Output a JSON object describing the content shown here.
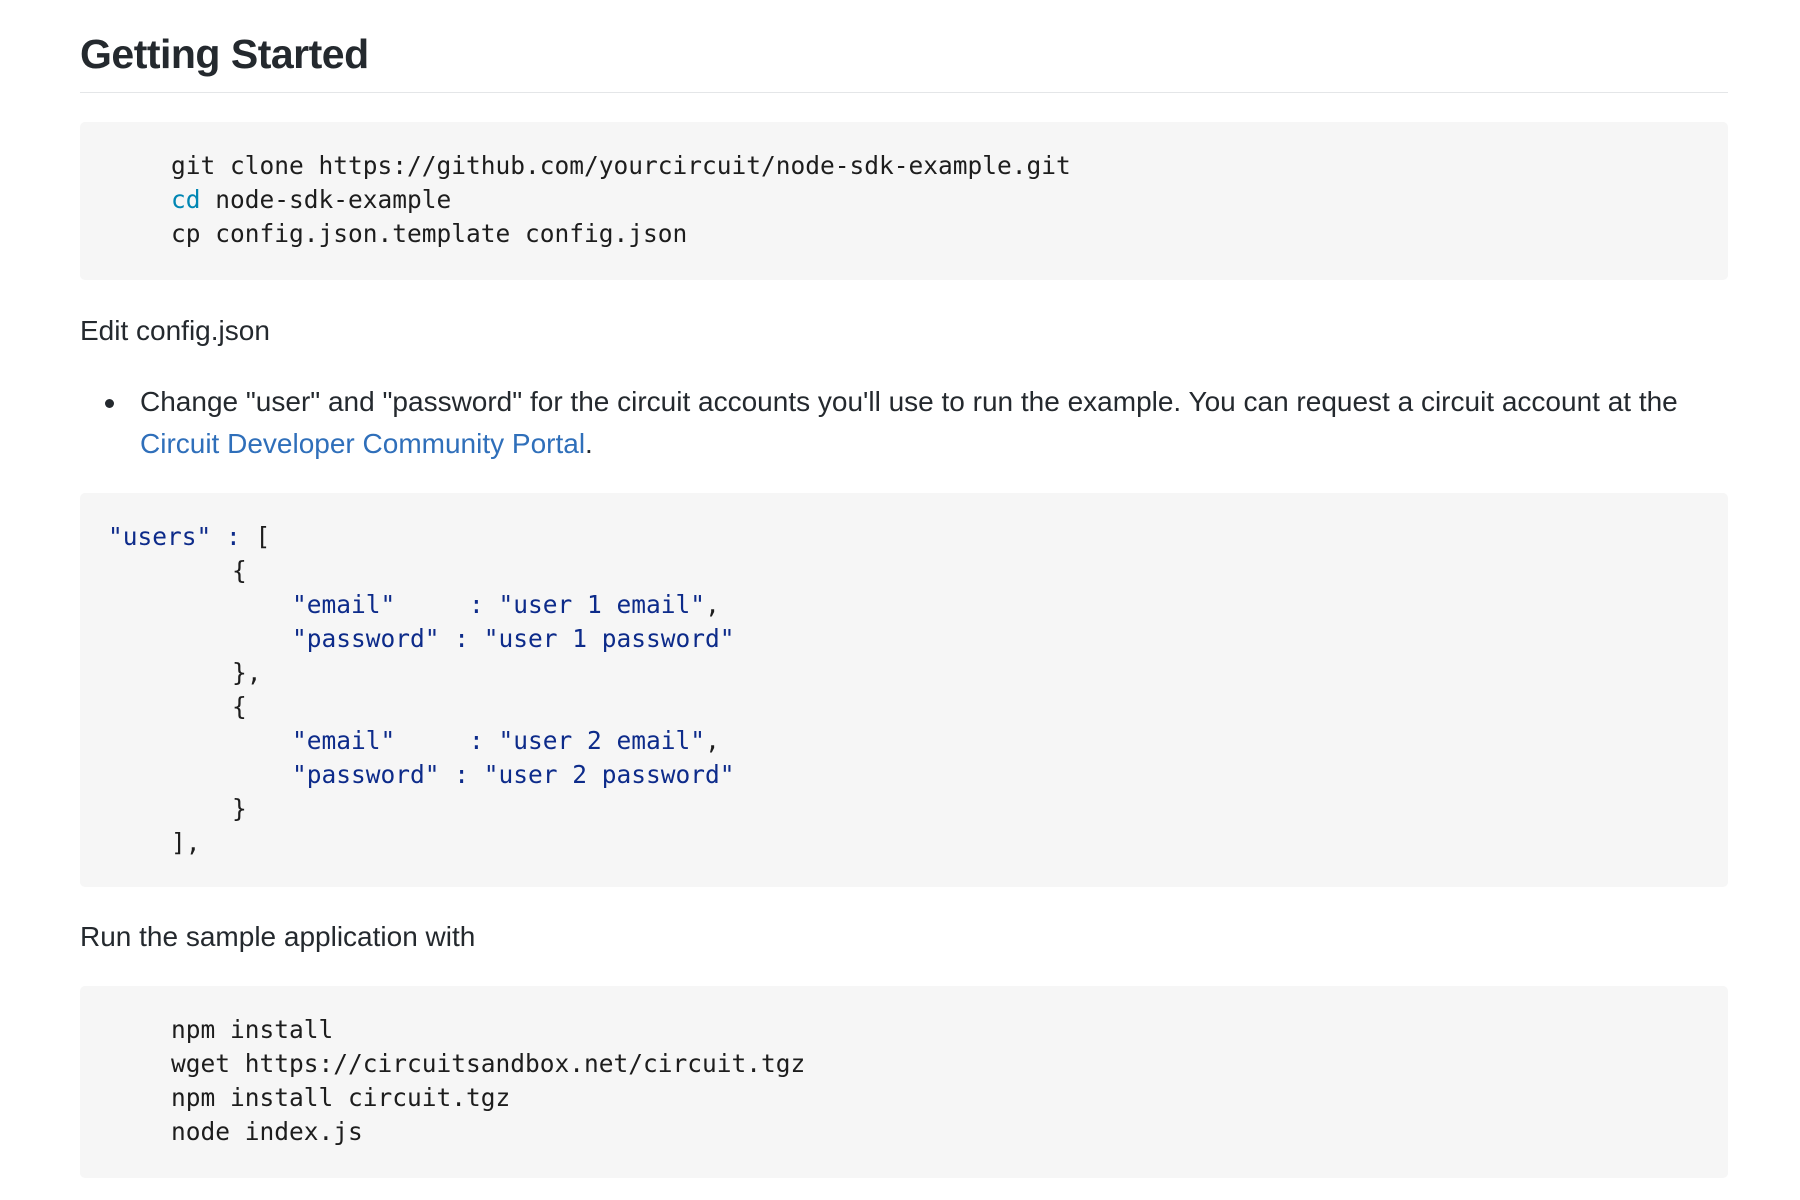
{
  "heading": "Getting Started",
  "code_clone": {
    "line1": "git clone https://github.com/yourcircuit/node-sdk-example.git",
    "line2_cmd": "cd",
    "line2_rest": " node-sdk-example",
    "line3": "cp config.json.template config.json"
  },
  "edit_text": "Edit config.json",
  "bullet": {
    "text_before": "Change \"user\" and \"password\" for the circuit accounts you'll use to run the example. You can request a circuit account at the ",
    "link_text": "Circuit Developer Community Portal",
    "text_after": "."
  },
  "code_config": {
    "users_key": "\"users\"",
    "colon": " : ",
    "open_bracket": "[",
    "open_brace": "{",
    "close_brace_comma": "},",
    "close_brace": "}",
    "close_bracket": "],",
    "email_key": "\"email\"",
    "email_pad": "    ",
    "password_key": "\"password\"",
    "sep": " : ",
    "user1_email": "\"user 1 email\"",
    "user1_password": "\"user 1 password\"",
    "user2_email": "\"user 2 email\"",
    "user2_password": "\"user 2 password\"",
    "comma": ","
  },
  "run_text": "Run the sample application with",
  "code_run": {
    "line1": "npm install",
    "line2": "wget https://circuitsandbox.net/circuit.tgz",
    "line3": "npm install circuit.tgz",
    "line4": "node index.js"
  },
  "colors": {
    "link": "#2f6fba",
    "code_bg": "#f6f6f6",
    "string": "#0d2b8a",
    "command": "#0086b3"
  }
}
